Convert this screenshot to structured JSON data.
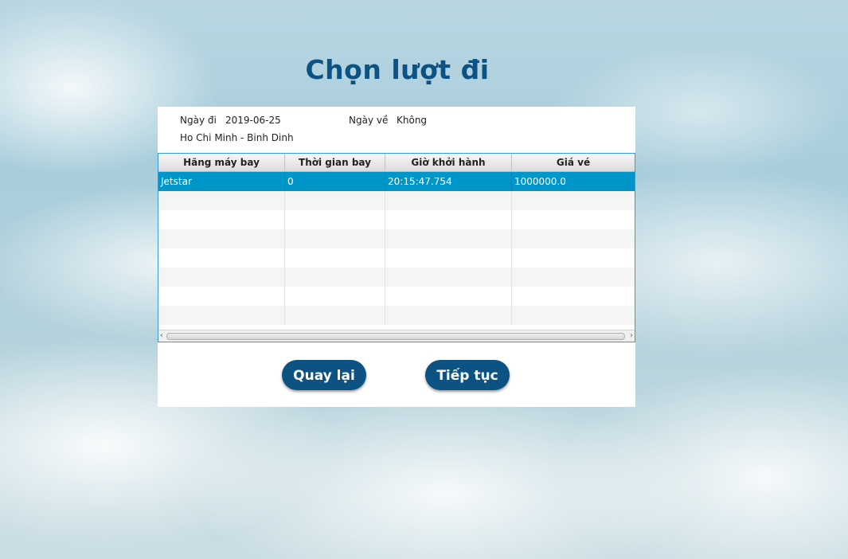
{
  "title": "Chọn lượt đi",
  "info": {
    "depart_label": "Ngày đi",
    "depart_value": "2019-06-25",
    "return_label": "Ngày về",
    "return_value": "Không",
    "route": "Ho Chi Minh - Binh Dinh"
  },
  "table": {
    "columns": [
      "Hãng máy bay",
      "Thời gian bay",
      "Giờ khởi hành",
      "Giá vé"
    ],
    "rows": [
      {
        "airline": "Jetstar",
        "duration": "0",
        "departure": "20:15:47.754",
        "price": "1000000.0"
      }
    ],
    "selected_row": 0
  },
  "buttons": {
    "back": "Quay lại",
    "next": "Tiếp tục"
  }
}
